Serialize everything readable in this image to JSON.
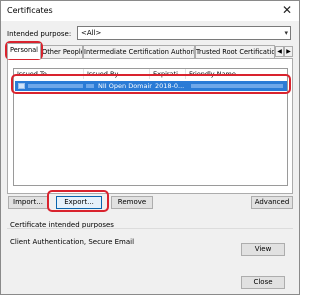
{
  "window": {
    "title": "Certificates",
    "close_glyph": "✕"
  },
  "purpose": {
    "label": "Intended purpose:",
    "value": "<All>"
  },
  "tabs": [
    {
      "label": "Personal"
    },
    {
      "label": "Other People"
    },
    {
      "label": "Intermediate Certification Authorities"
    },
    {
      "label": "Trusted Root Certification"
    }
  ],
  "tab_nav": {
    "prev": "◀",
    "next": "▶"
  },
  "table": {
    "headers": [
      "Issued To",
      "Issued By",
      "Expirati...",
      "Friendly Name"
    ],
    "rows": [
      {
        "issued_to": "",
        "issued_by": "NII Open Domain ...",
        "expiration": "2018-0...",
        "friendly_name": ""
      }
    ]
  },
  "buttons": {
    "import": "Import...",
    "export": "Export...",
    "remove": "Remove",
    "advanced": "Advanced",
    "view": "View",
    "close": "Close"
  },
  "purposes_group": {
    "label": "Certificate intended purposes",
    "value": "Client Authentication, Secure Email"
  },
  "colors": {
    "highlight_red": "#d9232e",
    "selection_blue": "#2a7bd6"
  }
}
